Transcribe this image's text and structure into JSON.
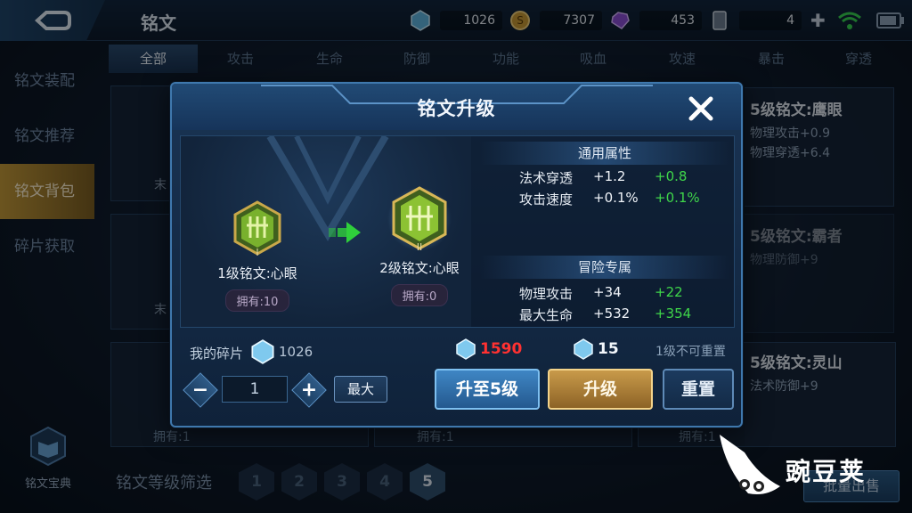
{
  "header": {
    "title": "铭文",
    "resources": [
      {
        "icon": "crystal-icon",
        "value": "1026"
      },
      {
        "icon": "gold-coin-icon",
        "value": "7307"
      },
      {
        "icon": "gem-icon",
        "value": "453"
      },
      {
        "icon": "card-icon",
        "value": "4"
      }
    ]
  },
  "tabs": [
    "全部",
    "攻击",
    "生命",
    "防御",
    "功能",
    "吸血",
    "攻速",
    "暴击",
    "穿透"
  ],
  "sidebar": [
    {
      "label": "铭文装配"
    },
    {
      "label": "铭文推荐"
    },
    {
      "label": "铭文背包"
    },
    {
      "label": "碎片获取"
    }
  ],
  "background_cards": {
    "left_partials": [
      "末",
      "末"
    ],
    "owned": [
      "拥有:1",
      "拥有:1",
      "拥有:1"
    ],
    "right": [
      {
        "title": "5级铭文:鹰眼",
        "lines": [
          "物理攻击+0.9",
          "物理穿透+6.4"
        ]
      },
      {
        "title": "5级铭文:霸者",
        "lines": [
          "物理防御+9"
        ]
      },
      {
        "title": "5级铭文:灵山",
        "lines": [
          "法术防御+9"
        ]
      }
    ]
  },
  "bottom": {
    "codex_label": "铭文宝典",
    "filter_label": "铭文等级筛选",
    "levels": [
      "1",
      "2",
      "3",
      "4",
      "5"
    ],
    "batch_button": "批量出售"
  },
  "modal": {
    "title": "铭文升级",
    "from": {
      "name": "1级铭文:心眼",
      "owned": "拥有:10",
      "roman": "I"
    },
    "to": {
      "name": "2级铭文:心眼",
      "owned": "拥有:0",
      "roman": "II"
    },
    "general_header": "通用属性",
    "general_stats": [
      {
        "key": "法术穿透",
        "value": "+1.2",
        "delta": "+0.8"
      },
      {
        "key": "攻击速度",
        "value": "+0.1%",
        "delta": "+0.1%"
      }
    ],
    "adventure_header": "冒险专属",
    "adventure_stats": [
      {
        "key": "物理攻击",
        "value": "+34",
        "delta": "+22"
      },
      {
        "key": "最大生命",
        "value": "+532",
        "delta": "+354"
      }
    ],
    "shards_label": "我的碎片",
    "shards_value": "1026",
    "quantity": "1",
    "max_button": "最大",
    "cost_to_max": "1590",
    "cost_single": "15",
    "note": "1级不可重置",
    "btn_upgrade_to_5": "升至5级",
    "btn_upgrade": "升级",
    "btn_reset": "重置"
  },
  "watermark": "豌豆荚",
  "colors": {
    "accent_blue": "#3f86c4",
    "gold": "#c89a4a",
    "delta_green": "#3fd64a",
    "cost_red": "#ff3131"
  }
}
